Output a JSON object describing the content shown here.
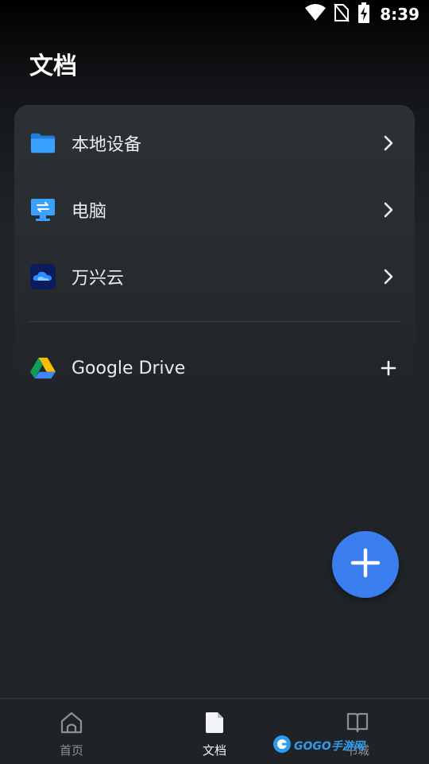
{
  "status_bar": {
    "time": "8:39",
    "icons": [
      "wifi-icon",
      "no-sim-icon",
      "battery-charging-icon"
    ]
  },
  "page": {
    "title": "文档"
  },
  "locations": [
    {
      "label": "本地设备",
      "icon": "folder-icon",
      "action": "chevron-right-icon"
    },
    {
      "label": "电脑",
      "icon": "computer-icon",
      "action": "chevron-right-icon"
    },
    {
      "label": "万兴云",
      "icon": "cloud-icon",
      "action": "chevron-right-icon"
    }
  ],
  "services": [
    {
      "label": "Google Drive",
      "icon": "google-drive-icon",
      "action": "plus-icon"
    }
  ],
  "fab": {
    "icon": "plus-icon"
  },
  "bottom_nav": [
    {
      "label": "首页",
      "icon": "home-icon",
      "active": false
    },
    {
      "label": "文档",
      "icon": "document-icon",
      "active": true
    },
    {
      "label": "书城",
      "icon": "book-icon",
      "active": false
    }
  ],
  "watermark": {
    "text": "GOGO手游网"
  },
  "colors": {
    "background": "#212529",
    "card": "#2c3136",
    "accent": "#3a7ef0",
    "folder_blue": "#2e8ff0"
  }
}
